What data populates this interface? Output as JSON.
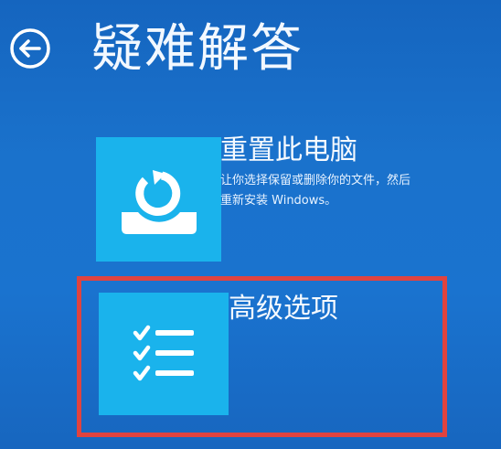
{
  "page": {
    "title": "疑难解答",
    "back_icon": "back-arrow-icon"
  },
  "options": [
    {
      "title": "重置此电脑",
      "description_lines": [
        "让你选择保留或删除你的文件，然后",
        "重新安装 Windows。"
      ],
      "icon": "reset-pc-icon"
    },
    {
      "title": "高级选项",
      "icon": "checklist-icon"
    }
  ],
  "colors": {
    "background": "#1a72cc",
    "tile": "#1ab3ec",
    "highlight": "#e0433f"
  }
}
